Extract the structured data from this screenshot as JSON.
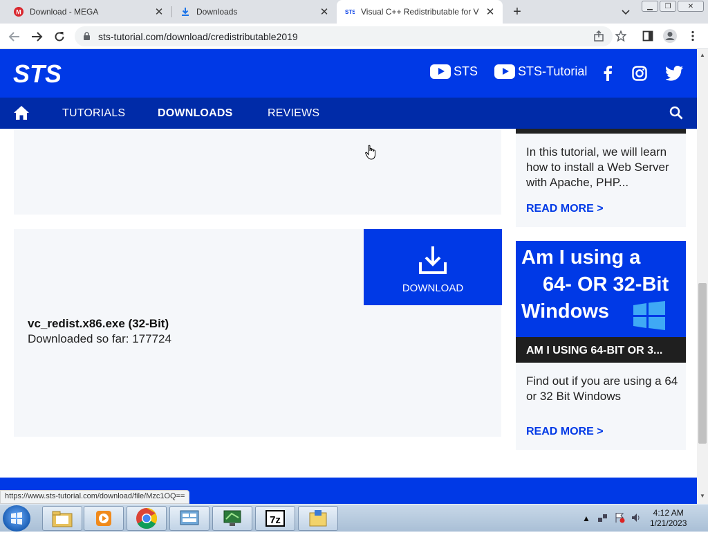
{
  "browser": {
    "tabs": [
      {
        "title": "Download - MEGA",
        "icon": "mega-icon"
      },
      {
        "title": "Downloads",
        "icon": "download-icon"
      },
      {
        "title": "Visual C++ Redistributable for V",
        "icon": "sts-favicon"
      }
    ],
    "url": "sts-tutorial.com/download/credistributable2019",
    "status_url": "https://www.sts-tutorial.com/download/file/Mzc1OQ=="
  },
  "site": {
    "logo": "STS",
    "youtube1": "STS",
    "youtube2": "STS-Tutorial",
    "nav": {
      "tutorials": "TUTORIALS",
      "downloads": "DOWNLOADS",
      "reviews": "REVIEWS"
    }
  },
  "download": {
    "button_label": "DOWNLOAD",
    "file_name": "vc_redist.x86.exe (32-Bit)",
    "count_text": "Downloaded so far: 177724"
  },
  "sidebar": {
    "card1": {
      "text": "In this tutorial, we will learn how to install a Web Server with Apache, PHP...",
      "read_more": "READ MORE"
    },
    "card2": {
      "hero_line1": "Am I using a",
      "hero_line2": "64- OR 32-Bit",
      "hero_line3": "Windows",
      "caption": "AM I USING 64-BIT OR 3...",
      "text": "Find out if you are using a 64 or 32 Bit Windows",
      "read_more": "READ MORE"
    }
  },
  "taskbar": {
    "time": "4:12 AM",
    "date": "1/21/2023"
  },
  "colors": {
    "brand_blue": "#0039e6",
    "nav_blue": "#002ba8"
  }
}
